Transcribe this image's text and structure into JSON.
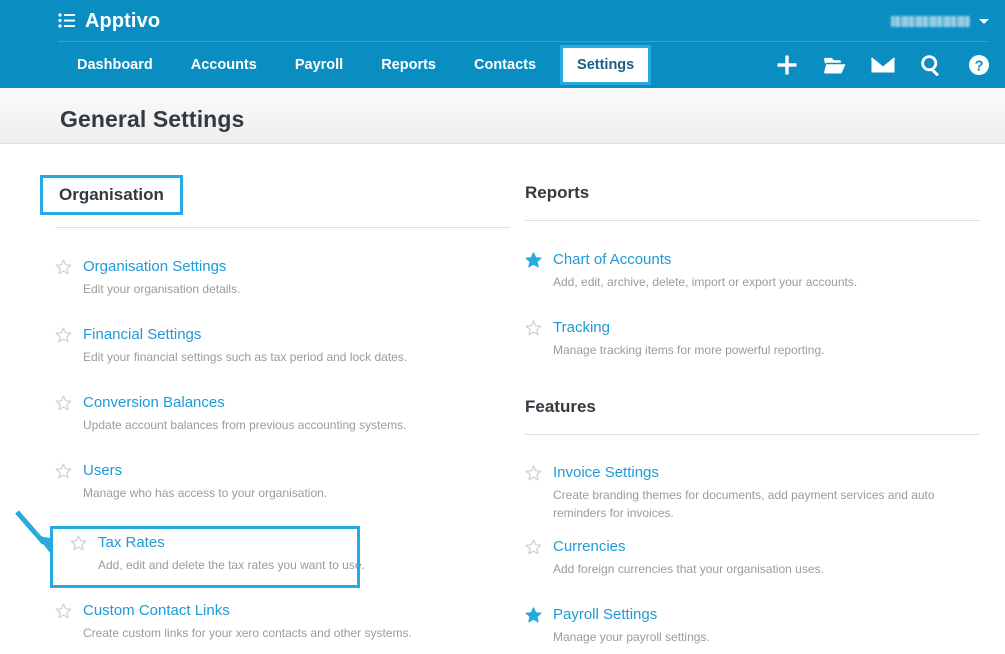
{
  "app": {
    "name": "Apptivo",
    "logo_icon": "list-icon"
  },
  "topbar": {
    "user_name": "",
    "user_caret_icon": "chevron-down-icon",
    "nav": [
      {
        "label": "Dashboard",
        "highlighted": false
      },
      {
        "label": "Accounts",
        "highlighted": false
      },
      {
        "label": "Payroll",
        "highlighted": false
      },
      {
        "label": "Reports",
        "highlighted": false
      },
      {
        "label": "Contacts",
        "highlighted": false
      },
      {
        "label": "Settings",
        "highlighted": true
      }
    ],
    "icons": [
      {
        "name": "plus-icon",
        "title": "Add"
      },
      {
        "name": "folder-icon",
        "title": "Files"
      },
      {
        "name": "envelope-icon",
        "title": "Messages"
      },
      {
        "name": "search-icon",
        "title": "Search"
      },
      {
        "name": "help-icon",
        "title": "Help"
      }
    ]
  },
  "page": {
    "title": "General Settings"
  },
  "colors": {
    "brand_blue": "#0a8ec1",
    "link_blue": "#1f9ad6",
    "highlight_cyan": "#27aae1",
    "star_on": "#27aae1",
    "star_off": "#d2d2d2",
    "desc_gray": "#9b9b9b",
    "heading_dark": "#333a40"
  },
  "sections": {
    "organisation": {
      "heading": "Organisation",
      "boxed": true,
      "items": [
        {
          "title": "Organisation Settings",
          "desc": "Edit your organisation details.",
          "starred": false,
          "boxed": false
        },
        {
          "title": "Financial Settings",
          "desc": "Edit your financial settings such as tax period and lock dates.",
          "starred": false,
          "boxed": false
        },
        {
          "title": "Conversion Balances",
          "desc": "Update account balances from previous accounting systems.",
          "starred": false,
          "boxed": false
        },
        {
          "title": "Users",
          "desc": "Manage who has access to your organisation.",
          "starred": false,
          "boxed": false
        },
        {
          "title": "Tax Rates",
          "desc": "Add, edit and delete the tax rates you want to use.",
          "starred": false,
          "boxed": true
        },
        {
          "title": "Custom Contact Links",
          "desc": "Create custom links for your xero contacts and other systems.",
          "starred": false,
          "boxed": false
        }
      ]
    },
    "reports": {
      "heading": "Reports",
      "boxed": false,
      "items": [
        {
          "title": "Chart of Accounts",
          "desc": "Add, edit, archive, delete, import or export your accounts.",
          "starred": true,
          "boxed": false
        },
        {
          "title": "Tracking",
          "desc": "Manage tracking items for more powerful reporting.",
          "starred": false,
          "boxed": false
        }
      ]
    },
    "features": {
      "heading": "Features",
      "boxed": false,
      "items": [
        {
          "title": "Invoice Settings",
          "desc": "Create branding themes for documents, add payment services and auto reminders for invoices.",
          "starred": false,
          "boxed": false
        },
        {
          "title": "Currencies",
          "desc": "Add foreign currencies that your organisation uses.",
          "starred": false,
          "boxed": false
        },
        {
          "title": "Payroll Settings",
          "desc": "Manage your payroll settings.",
          "starred": true,
          "boxed": false
        }
      ]
    }
  },
  "annotations": {
    "arrow": {
      "name": "pointer-arrow",
      "points_to": "Tax Rates"
    }
  }
}
